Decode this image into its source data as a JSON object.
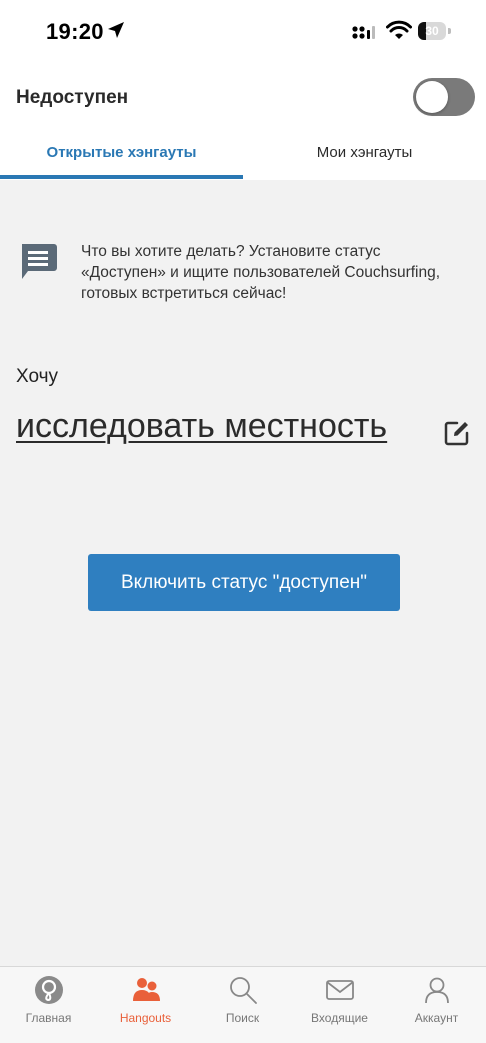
{
  "status_bar": {
    "time": "19:20",
    "battery": "30"
  },
  "header": {
    "availability_label": "Недоступен",
    "toggle_on": false
  },
  "tabs": [
    {
      "label": "Открытые хэнгауты",
      "active": true
    },
    {
      "label": "Мои хэнгауты",
      "active": false
    }
  ],
  "info": {
    "text": "Что вы хотите делать? Установите статус «Доступен» и ищите пользователей Couchsurfing, готовых встретиться сейчас!"
  },
  "want": {
    "label": "Хочу",
    "activity": "исследовать местность"
  },
  "cta": {
    "label": "Включить статус \"доступен\""
  },
  "bottom_nav": [
    {
      "label": "Главная",
      "icon": "home-logo-icon",
      "active": false
    },
    {
      "label": "Hangouts",
      "icon": "people-icon",
      "active": true
    },
    {
      "label": "Поиск",
      "icon": "search-icon",
      "active": false
    },
    {
      "label": "Входящие",
      "icon": "envelope-icon",
      "active": false
    },
    {
      "label": "Аккаунт",
      "icon": "person-icon",
      "active": false
    }
  ],
  "colors": {
    "accent_blue": "#2a78b4",
    "button_blue": "#2f7fc0",
    "active_orange": "#e9603a"
  }
}
